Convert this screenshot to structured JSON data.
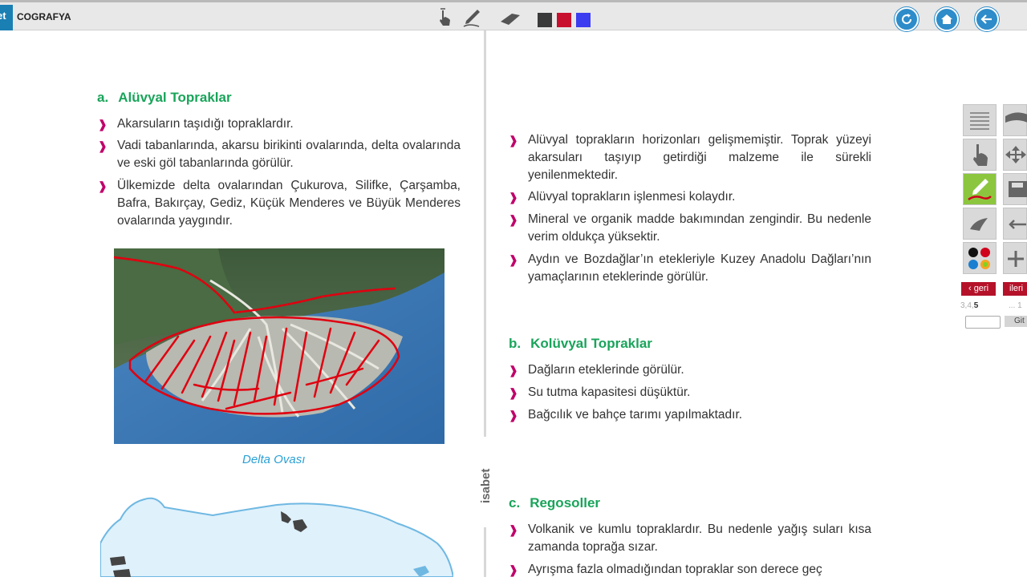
{
  "app": {
    "logo_text": "et",
    "title": "COGRAFYA"
  },
  "toolbar": {
    "tools": [
      "pointer-hand-icon",
      "pen-icon",
      "eraser-icon"
    ],
    "swatches": [
      "#3a3a3a",
      "#c8102e",
      "#3c3cf0"
    ],
    "nav": [
      "refresh-icon",
      "home-icon",
      "back-arrow-icon"
    ]
  },
  "left": {
    "section_a": {
      "letter": "a.",
      "title": "Alüvyal Topraklar"
    },
    "bullets": [
      "Akarsuların taşıdığı topraklardır.",
      "Vadi tabanlarında, akarsu birikinti ovalarında, delta ovalarında ve eski göl tabanlarında görülür.",
      "Ülkemizde delta ovalarından Çukurova, Silifke, Çarşamba, Bafra, Bakırçay, Gediz, Küçük Menderes ve Büyük Menderes ovalarında yaygındır."
    ],
    "caption": "Delta Ovası"
  },
  "right": {
    "bullets_a": [
      "Alüvyal toprakların horizonları gelişmemiştir. Toprak yüzeyi akarsuları taşıyıp getirdiği malzeme ile  sürekli yenilenmektedir.",
      "Alüvyal toprakların işlenmesi kolaydır.",
      "Mineral ve organik madde bakımından zengindir. Bu nedenle verim oldukça yüksektir.",
      "Aydın ve Bozdağlar’ın etekleriyle Kuzey Anadolu Dağları’nın yamaçlarının eteklerinde görülür."
    ],
    "section_b": {
      "letter": "b.",
      "title": "Kolüvyal Topraklar"
    },
    "bullets_b": [
      "Dağların eteklerinde görülür.",
      "Su tutma kapasitesi düşüktür.",
      "Bağcılık ve bahçe tarımı yapılmaktadır."
    ],
    "section_c": {
      "letter": "c.",
      "title": "Regosoller"
    },
    "bullets_c": [
      "Volkanik ve kumlu topraklardır. Bu nedenle yağış suları kısa zamanda toprağa sızar.",
      "Ayrışma fazla olmadığından topraklar son derece geç"
    ]
  },
  "spine_brand": "isabet",
  "sidepanel": {
    "geri_label": "geri",
    "ileri_label": "ileri",
    "page_prefix": "3,4,",
    "page_current": "5",
    "page_suffix": "... 1",
    "go_label": "Git"
  },
  "colors": {
    "heading": "#19a45a",
    "bullet": "#c0006a",
    "caption": "#2aa0d5",
    "nav": "#2d8cc9",
    "pager": "#b5122a"
  }
}
